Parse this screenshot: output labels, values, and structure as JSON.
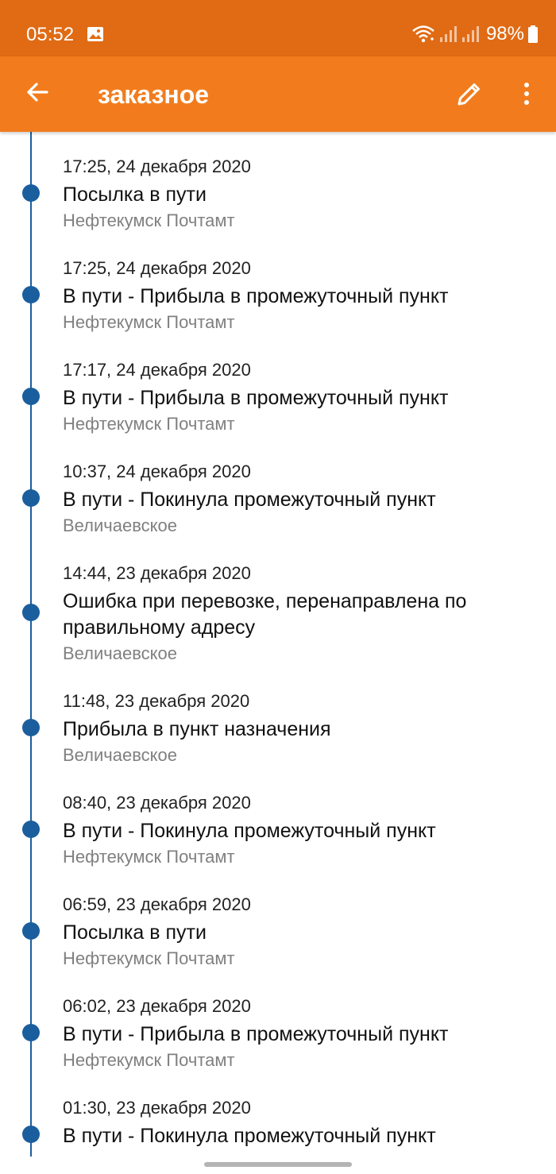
{
  "status_bar": {
    "time": "05:52",
    "battery": "98%",
    "icons": [
      "gallery-icon",
      "wifi-icon",
      "signal-icon",
      "signal-icon",
      "battery-icon"
    ]
  },
  "app_bar": {
    "title": "заказное",
    "icons": [
      "back-arrow-icon",
      "pencil-icon",
      "more-vert-icon"
    ],
    "color": "#f27c1d"
  },
  "colors": {
    "status_bar": "#e06b14",
    "timeline": "#1a5e9e",
    "location_text": "#808080"
  },
  "events": [
    {
      "date": "17:25, 24 декабря 2020",
      "status": "Посылка в пути",
      "location": "Нефтекумск Почтамт"
    },
    {
      "date": "17:25, 24 декабря 2020",
      "status": "В пути - Прибыла в промежуточный пункт",
      "location": "Нефтекумск Почтамт"
    },
    {
      "date": "17:17, 24 декабря 2020",
      "status": "В пути - Прибыла в промежуточный пункт",
      "location": "Нефтекумск Почтамт"
    },
    {
      "date": "10:37, 24 декабря 2020",
      "status": "В пути - Покинула промежуточный пункт",
      "location": "Величаевское"
    },
    {
      "date": "14:44, 23 декабря 2020",
      "status": "Ошибка при перевозке, перенаправлена по правильному адресу",
      "location": "Величаевское"
    },
    {
      "date": "11:48, 23 декабря 2020",
      "status": "Прибыла в пункт назначения",
      "location": "Величаевское"
    },
    {
      "date": "08:40, 23 декабря 2020",
      "status": "В пути - Покинула промежуточный пункт",
      "location": "Нефтекумск Почтамт"
    },
    {
      "date": "06:59, 23 декабря 2020",
      "status": "Посылка в пути",
      "location": "Нефтекумск Почтамт"
    },
    {
      "date": "06:02, 23 декабря 2020",
      "status": "В пути - Прибыла в промежуточный пункт",
      "location": "Нефтекумск Почтамт"
    },
    {
      "date": "01:30, 23 декабря 2020",
      "status": "В пути - Покинула промежуточный пункт",
      "location": ""
    }
  ]
}
